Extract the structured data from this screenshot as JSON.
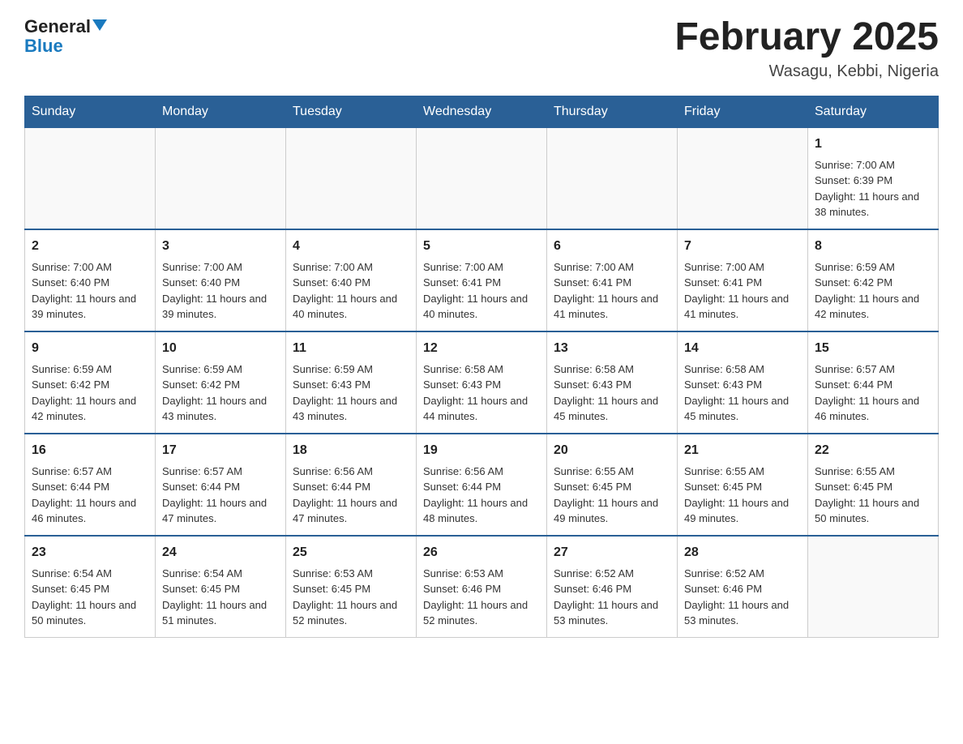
{
  "header": {
    "logo_general": "General",
    "logo_blue": "Blue",
    "title": "February 2025",
    "subtitle": "Wasagu, Kebbi, Nigeria"
  },
  "days_of_week": [
    "Sunday",
    "Monday",
    "Tuesday",
    "Wednesday",
    "Thursday",
    "Friday",
    "Saturday"
  ],
  "weeks": [
    [
      {
        "day": "",
        "sunrise": "",
        "sunset": "",
        "daylight": "",
        "empty": true
      },
      {
        "day": "",
        "sunrise": "",
        "sunset": "",
        "daylight": "",
        "empty": true
      },
      {
        "day": "",
        "sunrise": "",
        "sunset": "",
        "daylight": "",
        "empty": true
      },
      {
        "day": "",
        "sunrise": "",
        "sunset": "",
        "daylight": "",
        "empty": true
      },
      {
        "day": "",
        "sunrise": "",
        "sunset": "",
        "daylight": "",
        "empty": true
      },
      {
        "day": "",
        "sunrise": "",
        "sunset": "",
        "daylight": "",
        "empty": true
      },
      {
        "day": "1",
        "sunrise": "Sunrise: 7:00 AM",
        "sunset": "Sunset: 6:39 PM",
        "daylight": "Daylight: 11 hours and 38 minutes.",
        "empty": false
      }
    ],
    [
      {
        "day": "2",
        "sunrise": "Sunrise: 7:00 AM",
        "sunset": "Sunset: 6:40 PM",
        "daylight": "Daylight: 11 hours and 39 minutes.",
        "empty": false
      },
      {
        "day": "3",
        "sunrise": "Sunrise: 7:00 AM",
        "sunset": "Sunset: 6:40 PM",
        "daylight": "Daylight: 11 hours and 39 minutes.",
        "empty": false
      },
      {
        "day": "4",
        "sunrise": "Sunrise: 7:00 AM",
        "sunset": "Sunset: 6:40 PM",
        "daylight": "Daylight: 11 hours and 40 minutes.",
        "empty": false
      },
      {
        "day": "5",
        "sunrise": "Sunrise: 7:00 AM",
        "sunset": "Sunset: 6:41 PM",
        "daylight": "Daylight: 11 hours and 40 minutes.",
        "empty": false
      },
      {
        "day": "6",
        "sunrise": "Sunrise: 7:00 AM",
        "sunset": "Sunset: 6:41 PM",
        "daylight": "Daylight: 11 hours and 41 minutes.",
        "empty": false
      },
      {
        "day": "7",
        "sunrise": "Sunrise: 7:00 AM",
        "sunset": "Sunset: 6:41 PM",
        "daylight": "Daylight: 11 hours and 41 minutes.",
        "empty": false
      },
      {
        "day": "8",
        "sunrise": "Sunrise: 6:59 AM",
        "sunset": "Sunset: 6:42 PM",
        "daylight": "Daylight: 11 hours and 42 minutes.",
        "empty": false
      }
    ],
    [
      {
        "day": "9",
        "sunrise": "Sunrise: 6:59 AM",
        "sunset": "Sunset: 6:42 PM",
        "daylight": "Daylight: 11 hours and 42 minutes.",
        "empty": false
      },
      {
        "day": "10",
        "sunrise": "Sunrise: 6:59 AM",
        "sunset": "Sunset: 6:42 PM",
        "daylight": "Daylight: 11 hours and 43 minutes.",
        "empty": false
      },
      {
        "day": "11",
        "sunrise": "Sunrise: 6:59 AM",
        "sunset": "Sunset: 6:43 PM",
        "daylight": "Daylight: 11 hours and 43 minutes.",
        "empty": false
      },
      {
        "day": "12",
        "sunrise": "Sunrise: 6:58 AM",
        "sunset": "Sunset: 6:43 PM",
        "daylight": "Daylight: 11 hours and 44 minutes.",
        "empty": false
      },
      {
        "day": "13",
        "sunrise": "Sunrise: 6:58 AM",
        "sunset": "Sunset: 6:43 PM",
        "daylight": "Daylight: 11 hours and 45 minutes.",
        "empty": false
      },
      {
        "day": "14",
        "sunrise": "Sunrise: 6:58 AM",
        "sunset": "Sunset: 6:43 PM",
        "daylight": "Daylight: 11 hours and 45 minutes.",
        "empty": false
      },
      {
        "day": "15",
        "sunrise": "Sunrise: 6:57 AM",
        "sunset": "Sunset: 6:44 PM",
        "daylight": "Daylight: 11 hours and 46 minutes.",
        "empty": false
      }
    ],
    [
      {
        "day": "16",
        "sunrise": "Sunrise: 6:57 AM",
        "sunset": "Sunset: 6:44 PM",
        "daylight": "Daylight: 11 hours and 46 minutes.",
        "empty": false
      },
      {
        "day": "17",
        "sunrise": "Sunrise: 6:57 AM",
        "sunset": "Sunset: 6:44 PM",
        "daylight": "Daylight: 11 hours and 47 minutes.",
        "empty": false
      },
      {
        "day": "18",
        "sunrise": "Sunrise: 6:56 AM",
        "sunset": "Sunset: 6:44 PM",
        "daylight": "Daylight: 11 hours and 47 minutes.",
        "empty": false
      },
      {
        "day": "19",
        "sunrise": "Sunrise: 6:56 AM",
        "sunset": "Sunset: 6:44 PM",
        "daylight": "Daylight: 11 hours and 48 minutes.",
        "empty": false
      },
      {
        "day": "20",
        "sunrise": "Sunrise: 6:55 AM",
        "sunset": "Sunset: 6:45 PM",
        "daylight": "Daylight: 11 hours and 49 minutes.",
        "empty": false
      },
      {
        "day": "21",
        "sunrise": "Sunrise: 6:55 AM",
        "sunset": "Sunset: 6:45 PM",
        "daylight": "Daylight: 11 hours and 49 minutes.",
        "empty": false
      },
      {
        "day": "22",
        "sunrise": "Sunrise: 6:55 AM",
        "sunset": "Sunset: 6:45 PM",
        "daylight": "Daylight: 11 hours and 50 minutes.",
        "empty": false
      }
    ],
    [
      {
        "day": "23",
        "sunrise": "Sunrise: 6:54 AM",
        "sunset": "Sunset: 6:45 PM",
        "daylight": "Daylight: 11 hours and 50 minutes.",
        "empty": false
      },
      {
        "day": "24",
        "sunrise": "Sunrise: 6:54 AM",
        "sunset": "Sunset: 6:45 PM",
        "daylight": "Daylight: 11 hours and 51 minutes.",
        "empty": false
      },
      {
        "day": "25",
        "sunrise": "Sunrise: 6:53 AM",
        "sunset": "Sunset: 6:45 PM",
        "daylight": "Daylight: 11 hours and 52 minutes.",
        "empty": false
      },
      {
        "day": "26",
        "sunrise": "Sunrise: 6:53 AM",
        "sunset": "Sunset: 6:46 PM",
        "daylight": "Daylight: 11 hours and 52 minutes.",
        "empty": false
      },
      {
        "day": "27",
        "sunrise": "Sunrise: 6:52 AM",
        "sunset": "Sunset: 6:46 PM",
        "daylight": "Daylight: 11 hours and 53 minutes.",
        "empty": false
      },
      {
        "day": "28",
        "sunrise": "Sunrise: 6:52 AM",
        "sunset": "Sunset: 6:46 PM",
        "daylight": "Daylight: 11 hours and 53 minutes.",
        "empty": false
      },
      {
        "day": "",
        "sunrise": "",
        "sunset": "",
        "daylight": "",
        "empty": true
      }
    ]
  ]
}
